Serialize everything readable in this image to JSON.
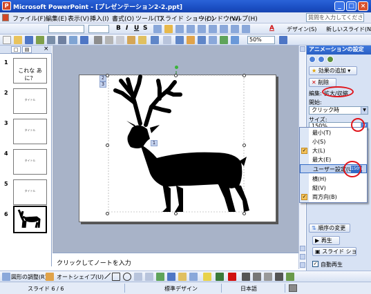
{
  "window": {
    "title": "Microsoft PowerPoint - [プレゼンテーション2-2.ppt]",
    "app_icon": "powerpoint-icon",
    "controls": [
      "_",
      "□",
      "×"
    ]
  },
  "menubar": {
    "items": [
      "ファイル(F)",
      "編集(E)",
      "表示(V)",
      "挿入(I)",
      "書式(O)",
      "ツール(T)",
      "スライド ショー(D)",
      "ウィンドウ(W)",
      "ヘルプ(H)"
    ],
    "help_placeholder": "質問を入力してください"
  },
  "formatting_toolbar": {
    "bold": "B",
    "italic": "I",
    "underline": "U",
    "shadow": "S",
    "font_color_glyph": "A",
    "design_label": "デザイン(S)",
    "new_slide_label": "新しいスライド(N)"
  },
  "standard_toolbar": {
    "zoom": "50%"
  },
  "left_pane": {
    "tabs": [
      "□",
      "▤"
    ],
    "close": "×",
    "slides": [
      {
        "num": "1",
        "text": "これな あに？"
      },
      {
        "num": "2",
        "text": "タイトル"
      },
      {
        "num": "3",
        "text": "タイトル"
      },
      {
        "num": "4",
        "text": "タイトル"
      },
      {
        "num": "5",
        "text": "タイトル"
      },
      {
        "num": "6",
        "text": ""
      }
    ]
  },
  "slide": {
    "tags": [
      "2",
      "3"
    ],
    "center_tag": "1"
  },
  "notes": {
    "placeholder": "クリックしてノートを入力"
  },
  "task_pane": {
    "title": "アニメーションの設定",
    "add_effect": "効果の追加",
    "delete": "削除",
    "edit_label": "編集:",
    "edit_effect": "拡大/収縮",
    "start_label": "開始:",
    "start_value": "クリック時",
    "size_label": "サイズ:",
    "size_value": "150%",
    "reorder": "順序の変更",
    "play": "再生",
    "slideshow": "スライド ショー",
    "autopreview": "自動再生"
  },
  "size_menu": {
    "items": [
      {
        "label": "最小(T)",
        "checked": false
      },
      {
        "label": "小(S)",
        "checked": false
      },
      {
        "label": "大(L)",
        "checked": true
      },
      {
        "label": "最大(E)",
        "checked": false
      },
      {
        "label": "ユーザー設定(U)",
        "checked": false,
        "value": "150%"
      },
      {
        "label": "横(H)",
        "checked": false
      },
      {
        "label": "縦(V)",
        "checked": false
      },
      {
        "label": "両方向(B)",
        "checked": true
      }
    ]
  },
  "draw_toolbar": {
    "draw_menu": "図形の調整(R)",
    "autoshapes": "オートシェイプ(U)"
  },
  "status": {
    "slide": "スライド 6 / 6",
    "design": "標準デザイン",
    "language": "日本語"
  }
}
